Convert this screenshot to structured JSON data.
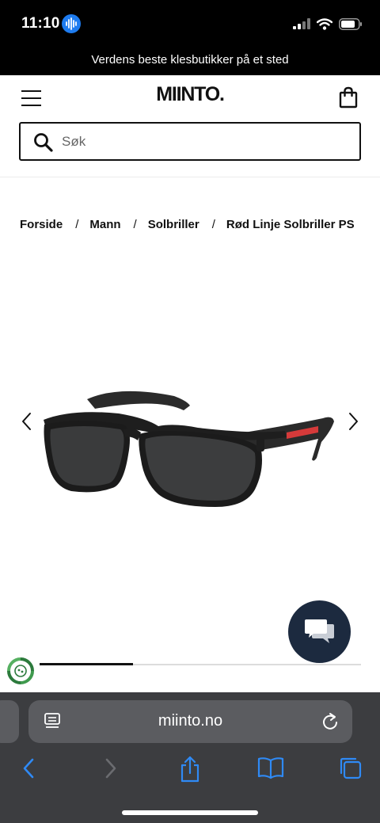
{
  "status_bar": {
    "time": "11:10",
    "icons": [
      "siri-icon",
      "signal-icon",
      "wifi-icon",
      "battery-icon"
    ]
  },
  "promo_banner": {
    "text": "Verdens beste klesbutikker på et sted"
  },
  "header": {
    "logo": "MIINTO.",
    "icons": [
      "menu-icon",
      "shopping-bag-icon"
    ]
  },
  "search": {
    "placeholder": "Søk",
    "value": ""
  },
  "breadcrumb": {
    "separator": "/",
    "items": [
      "Forside",
      "Mann",
      "Solbriller",
      "Rød Linje Solbriller PS"
    ]
  },
  "gallery": {
    "image": "sunglasses-product-image",
    "progress": 0.29,
    "icons": [
      "chevron-left-icon",
      "chevron-right-icon"
    ]
  },
  "chat": {
    "icon": "chat-bubbles-icon"
  },
  "browser": {
    "url": "miinto.no",
    "icons": [
      "reader-icon",
      "reload-icon",
      "back-icon",
      "forward-icon",
      "share-icon",
      "bookmarks-icon",
      "tabs-icon"
    ]
  },
  "colors": {
    "accent_blue": "#1e7cf0",
    "chat_button": "#1c2a3f",
    "frame_red": "#d63a3a",
    "browser_bg": "#3c3d40"
  }
}
